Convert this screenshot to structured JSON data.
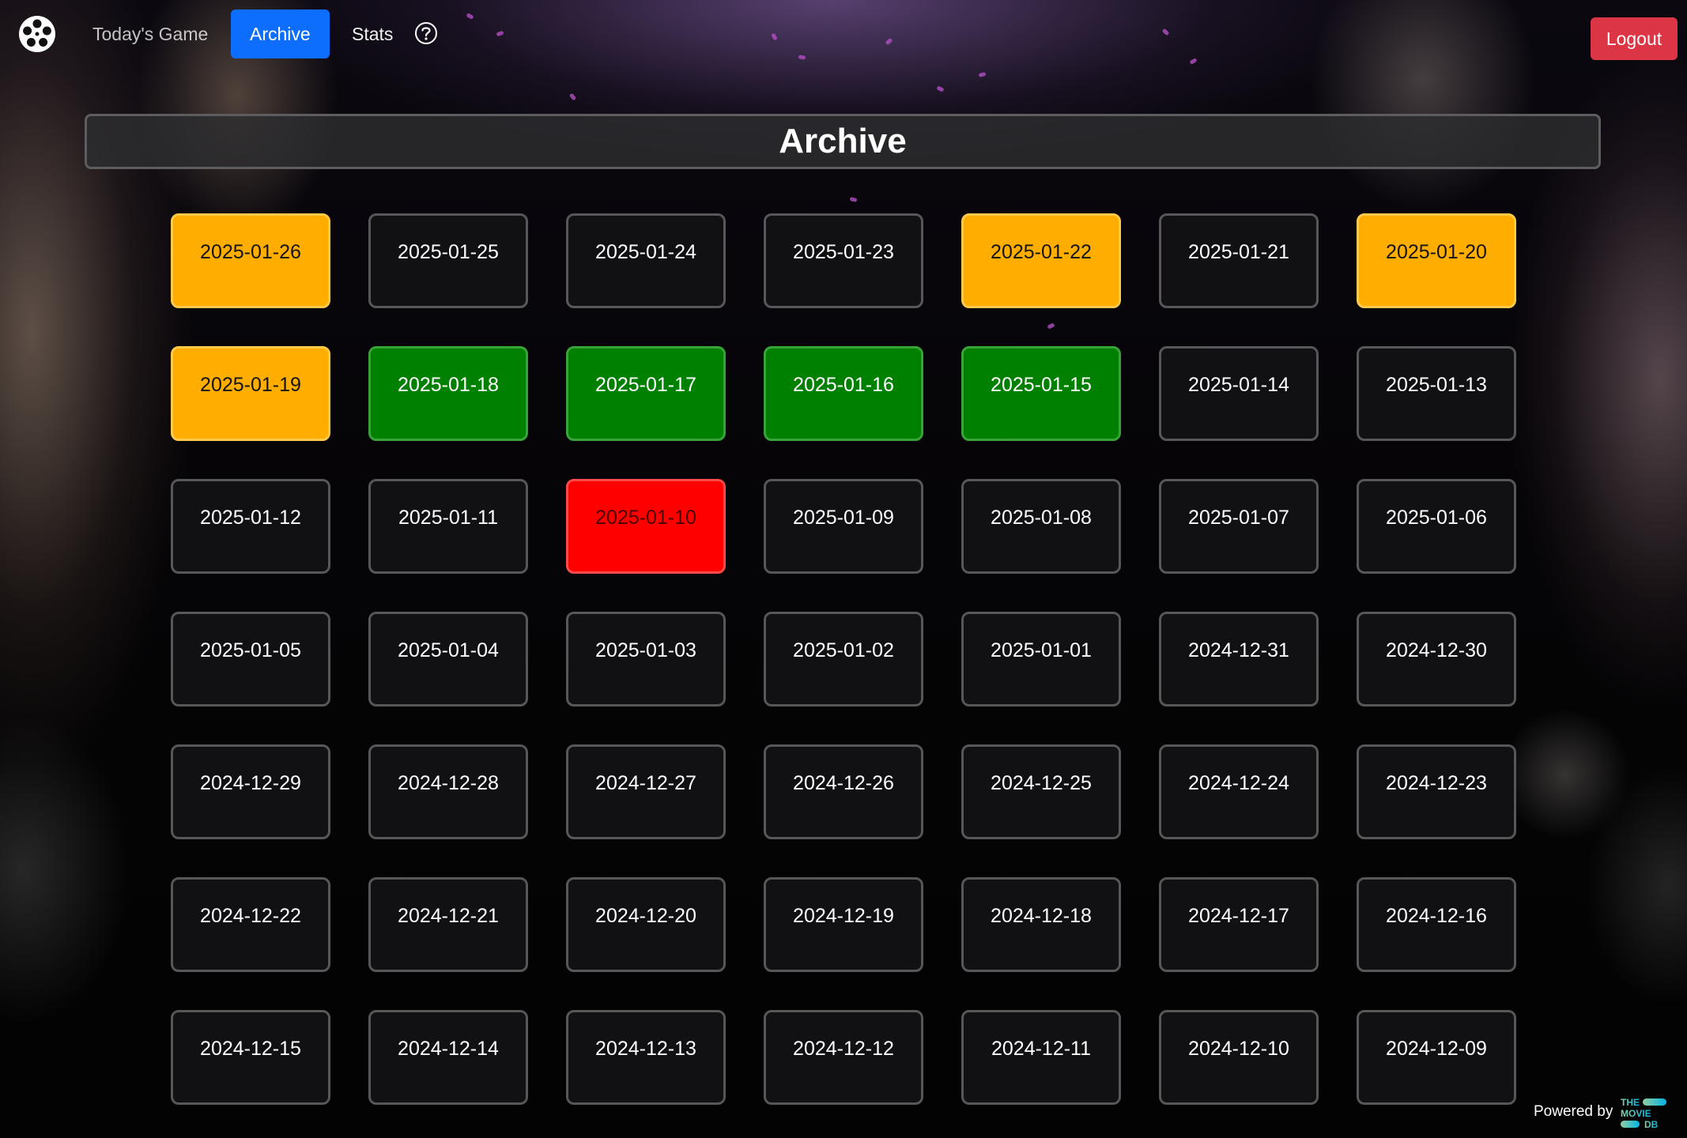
{
  "nav": {
    "links": [
      {
        "label": "Today's Game"
      },
      {
        "label": "Archive"
      },
      {
        "label": "Stats"
      }
    ],
    "logout_label": "Logout"
  },
  "page": {
    "title": "Archive"
  },
  "colors": {
    "win": "#008000",
    "loss": "#ff0000",
    "in_progress": "#ffae00",
    "default": "#121214",
    "nav_active": "#0d6efd",
    "logout": "#dc3545"
  },
  "dates": [
    {
      "date": "2025-01-26",
      "status": "in_progress"
    },
    {
      "date": "2025-01-25",
      "status": "default"
    },
    {
      "date": "2025-01-24",
      "status": "default"
    },
    {
      "date": "2025-01-23",
      "status": "default"
    },
    {
      "date": "2025-01-22",
      "status": "in_progress"
    },
    {
      "date": "2025-01-21",
      "status": "default"
    },
    {
      "date": "2025-01-20",
      "status": "in_progress"
    },
    {
      "date": "2025-01-19",
      "status": "in_progress"
    },
    {
      "date": "2025-01-18",
      "status": "win"
    },
    {
      "date": "2025-01-17",
      "status": "win"
    },
    {
      "date": "2025-01-16",
      "status": "win"
    },
    {
      "date": "2025-01-15",
      "status": "win"
    },
    {
      "date": "2025-01-14",
      "status": "default"
    },
    {
      "date": "2025-01-13",
      "status": "default"
    },
    {
      "date": "2025-01-12",
      "status": "default"
    },
    {
      "date": "2025-01-11",
      "status": "default"
    },
    {
      "date": "2025-01-10",
      "status": "loss"
    },
    {
      "date": "2025-01-09",
      "status": "default"
    },
    {
      "date": "2025-01-08",
      "status": "default"
    },
    {
      "date": "2025-01-07",
      "status": "default"
    },
    {
      "date": "2025-01-06",
      "status": "default"
    },
    {
      "date": "2025-01-05",
      "status": "default"
    },
    {
      "date": "2025-01-04",
      "status": "default"
    },
    {
      "date": "2025-01-03",
      "status": "default"
    },
    {
      "date": "2025-01-02",
      "status": "default"
    },
    {
      "date": "2025-01-01",
      "status": "default"
    },
    {
      "date": "2024-12-31",
      "status": "default"
    },
    {
      "date": "2024-12-30",
      "status": "default"
    },
    {
      "date": "2024-12-29",
      "status": "default"
    },
    {
      "date": "2024-12-28",
      "status": "default"
    },
    {
      "date": "2024-12-27",
      "status": "default"
    },
    {
      "date": "2024-12-26",
      "status": "default"
    },
    {
      "date": "2024-12-25",
      "status": "default"
    },
    {
      "date": "2024-12-24",
      "status": "default"
    },
    {
      "date": "2024-12-23",
      "status": "default"
    },
    {
      "date": "2024-12-22",
      "status": "default"
    },
    {
      "date": "2024-12-21",
      "status": "default"
    },
    {
      "date": "2024-12-20",
      "status": "default"
    },
    {
      "date": "2024-12-19",
      "status": "default"
    },
    {
      "date": "2024-12-18",
      "status": "default"
    },
    {
      "date": "2024-12-17",
      "status": "default"
    },
    {
      "date": "2024-12-16",
      "status": "default"
    },
    {
      "date": "2024-12-15",
      "status": "default"
    },
    {
      "date": "2024-12-14",
      "status": "default"
    },
    {
      "date": "2024-12-13",
      "status": "default"
    },
    {
      "date": "2024-12-12",
      "status": "default"
    },
    {
      "date": "2024-12-11",
      "status": "default"
    },
    {
      "date": "2024-12-10",
      "status": "default"
    },
    {
      "date": "2024-12-09",
      "status": "default"
    }
  ],
  "footer": {
    "powered_by": "Powered by",
    "tmdb_logo": {
      "line1": "THE",
      "line2": "MOVIE",
      "line3": "DB"
    }
  },
  "icons": {
    "logo": "film-reel-icon",
    "help": "question-circle-icon",
    "tmdb": "tmdb-logo-icon"
  }
}
